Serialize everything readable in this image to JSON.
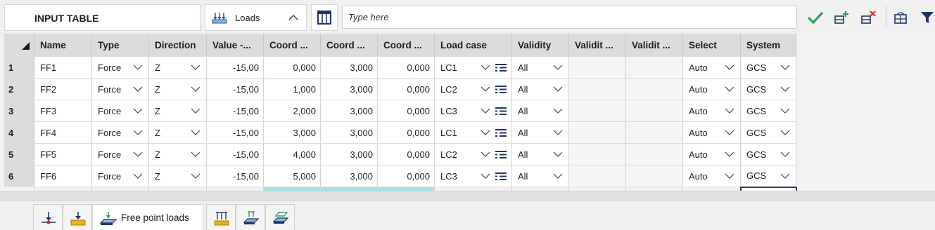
{
  "toolbar": {
    "title": "INPUT TABLE",
    "loads_label": "Loads",
    "search_placeholder": "Type here"
  },
  "table": {
    "headers": [
      "Name",
      "Type",
      "Direction",
      "Value -...",
      "Coord ...",
      "Coord ...",
      "Coord ...",
      "Load case",
      "Validity",
      "Validit ...",
      "Validit ...",
      "Select",
      "System"
    ],
    "rows": [
      {
        "num": "1",
        "name": "FF1",
        "type": "Force",
        "dir": "Z",
        "value": "-15,00",
        "c1": "0,000",
        "c2": "3,000",
        "c3": "0,000",
        "lc": "LC1",
        "validity": "All",
        "v2": "",
        "v3": "",
        "select": "Auto",
        "system": "GCS"
      },
      {
        "num": "2",
        "name": "FF2",
        "type": "Force",
        "dir": "Z",
        "value": "-15,00",
        "c1": "1,000",
        "c2": "3,000",
        "c3": "0,000",
        "lc": "LC2",
        "validity": "All",
        "v2": "",
        "v3": "",
        "select": "Auto",
        "system": "GCS"
      },
      {
        "num": "3",
        "name": "FF3",
        "type": "Force",
        "dir": "Z",
        "value": "-15,00",
        "c1": "2,000",
        "c2": "3,000",
        "c3": "0,000",
        "lc": "LC3",
        "validity": "All",
        "v2": "",
        "v3": "",
        "select": "Auto",
        "system": "GCS"
      },
      {
        "num": "4",
        "name": "FF4",
        "type": "Force",
        "dir": "Z",
        "value": "-15,00",
        "c1": "3,000",
        "c2": "3,000",
        "c3": "0,000",
        "lc": "LC1",
        "validity": "All",
        "v2": "",
        "v3": "",
        "select": "Auto",
        "system": "GCS"
      },
      {
        "num": "5",
        "name": "FF5",
        "type": "Force",
        "dir": "Z",
        "value": "-15,00",
        "c1": "4,000",
        "c2": "3,000",
        "c3": "0,000",
        "lc": "LC2",
        "validity": "All",
        "v2": "",
        "v3": "",
        "select": "Auto",
        "system": "GCS"
      },
      {
        "num": "6",
        "name": "FF6",
        "type": "Force",
        "dir": "Z",
        "value": "-15,00",
        "c1": "5,000",
        "c2": "3,000",
        "c3": "0,000",
        "lc": "LC3",
        "validity": "All",
        "v2": "",
        "v3": "",
        "select": "Auto",
        "system": "GCS"
      }
    ]
  },
  "bottom_tabs": {
    "active_label": "Free point loads"
  },
  "colors": {
    "accent_green": "#2aa35a",
    "accent_red": "#d42a2a",
    "icon_yellow": "#e8b21e",
    "icon_navy": "#1f3566",
    "new_row_teal": "#a7e1e2"
  }
}
